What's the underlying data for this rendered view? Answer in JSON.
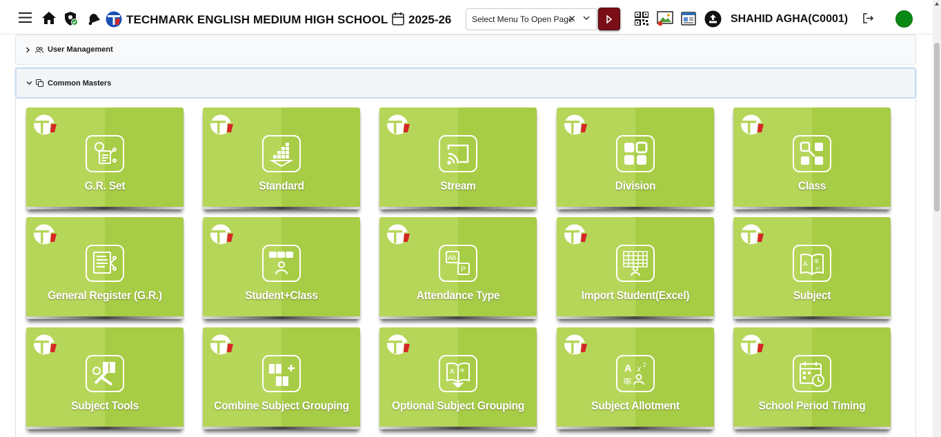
{
  "header": {
    "school_name": "TECHMARK ENGLISH MEDIUM HIGH SCHOOL",
    "academic_year": "2025-26",
    "menu_select_placeholder": "Select Menu To Open Page",
    "user_name": "SHAHID AGHA(C0001)",
    "icons": [
      "hamburger-menu-icon",
      "home-icon",
      "shield-check-icon",
      "bell-icon",
      "school-logo-icon",
      "calendar-icon",
      "qr-code-icon",
      "photo-gallery-icon",
      "id-card-icon",
      "upload-icon",
      "logout-icon"
    ],
    "status_color": "#0a8a14",
    "go_button_color": "#7a0d16"
  },
  "accordions": [
    {
      "label": "User Management",
      "expanded": false,
      "icon": "users-icon"
    },
    {
      "label": "Common Masters",
      "expanded": true,
      "icon": "copy-icon"
    }
  ],
  "tiles": [
    {
      "label": "G.R. Set",
      "icon": "gr-set-icon"
    },
    {
      "label": "Standard",
      "icon": "standard-icon"
    },
    {
      "label": "Stream",
      "icon": "stream-icon"
    },
    {
      "label": "Division",
      "icon": "division-icon"
    },
    {
      "label": "Class",
      "icon": "class-icon"
    },
    {
      "label": "General Register (G.R.)",
      "icon": "general-register-icon"
    },
    {
      "label": "Student+Class",
      "icon": "student-class-icon"
    },
    {
      "label": "Attendance Type",
      "icon": "attendance-type-icon"
    },
    {
      "label": "Import Student(Excel)",
      "icon": "import-student-icon"
    },
    {
      "label": "Subject",
      "icon": "subject-icon"
    },
    {
      "label": "Subject Tools",
      "icon": "subject-tools-icon"
    },
    {
      "label": "Combine Subject Grouping",
      "icon": "combine-subject-icon"
    },
    {
      "label": "Optional Subject Grouping",
      "icon": "optional-subject-icon"
    },
    {
      "label": "Subject Allotment",
      "icon": "subject-allotment-icon"
    },
    {
      "label": "School Period Timing",
      "icon": "period-timing-icon"
    }
  ],
  "tile_colors": {
    "light": "#b6d65a",
    "dark": "#a7cc45"
  }
}
